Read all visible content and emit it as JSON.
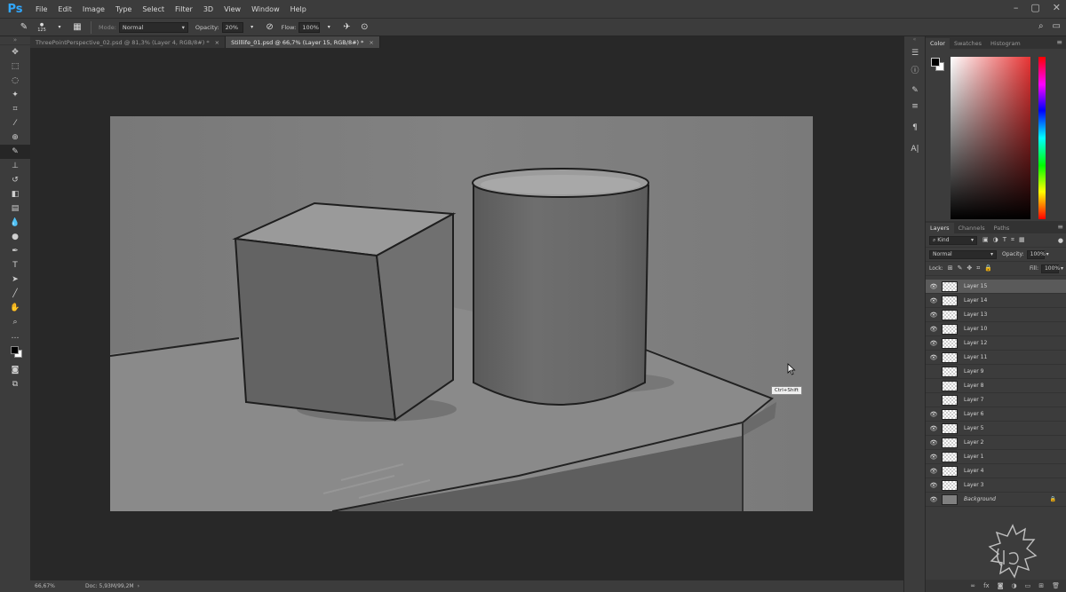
{
  "app": {
    "logo": "Ps"
  },
  "menu": [
    "File",
    "Edit",
    "Image",
    "Type",
    "Select",
    "Filter",
    "3D",
    "View",
    "Window",
    "Help"
  ],
  "options": {
    "brush_size": "125",
    "mode_label": "Mode:",
    "mode_value": "Normal",
    "opacity_label": "Opacity:",
    "opacity_value": "20%",
    "flow_label": "Flow:",
    "flow_value": "100%"
  },
  "tabs": [
    {
      "label": "ThreePointPerspective_02.psd @ 81,3% (Layer 4, RGB/8#) *",
      "close": "×"
    },
    {
      "label": "Stilllife_01.psd @ 66,7% (Layer 15, RGB/8#) *",
      "close": "×"
    }
  ],
  "status": {
    "zoom": "66,67%",
    "doc": "Doc: 5,93M/99,2M"
  },
  "color_panel": {
    "tabs": [
      "Color",
      "Swatches",
      "Histogram"
    ]
  },
  "layers_panel": {
    "tabs": [
      "Layers",
      "Channels",
      "Paths"
    ],
    "kind_label": "Kind",
    "blend_mode": "Normal",
    "opacity_label": "Opacity:",
    "opacity_value": "100%",
    "lock_label": "Lock:",
    "fill_label": "Fill:",
    "fill_value": "100%",
    "layers": [
      {
        "name": "Layer 15",
        "visible": true,
        "selected": true
      },
      {
        "name": "Layer 14",
        "visible": true
      },
      {
        "name": "Layer 13",
        "visible": true
      },
      {
        "name": "Layer 10",
        "visible": true
      },
      {
        "name": "Layer 12",
        "visible": true
      },
      {
        "name": "Layer 11",
        "visible": true
      },
      {
        "name": "Layer 9",
        "visible": false
      },
      {
        "name": "Layer 8",
        "visible": false
      },
      {
        "name": "Layer 7",
        "visible": false
      },
      {
        "name": "Layer 6",
        "visible": true
      },
      {
        "name": "Layer 5",
        "visible": true
      },
      {
        "name": "Layer 2",
        "visible": true
      },
      {
        "name": "Layer 1",
        "visible": true
      },
      {
        "name": "Layer 4",
        "visible": true
      },
      {
        "name": "Layer 3",
        "visible": true
      },
      {
        "name": "Background",
        "visible": true,
        "italic": true,
        "locked": true
      }
    ]
  },
  "tooltip": "Ctrl+Shift"
}
